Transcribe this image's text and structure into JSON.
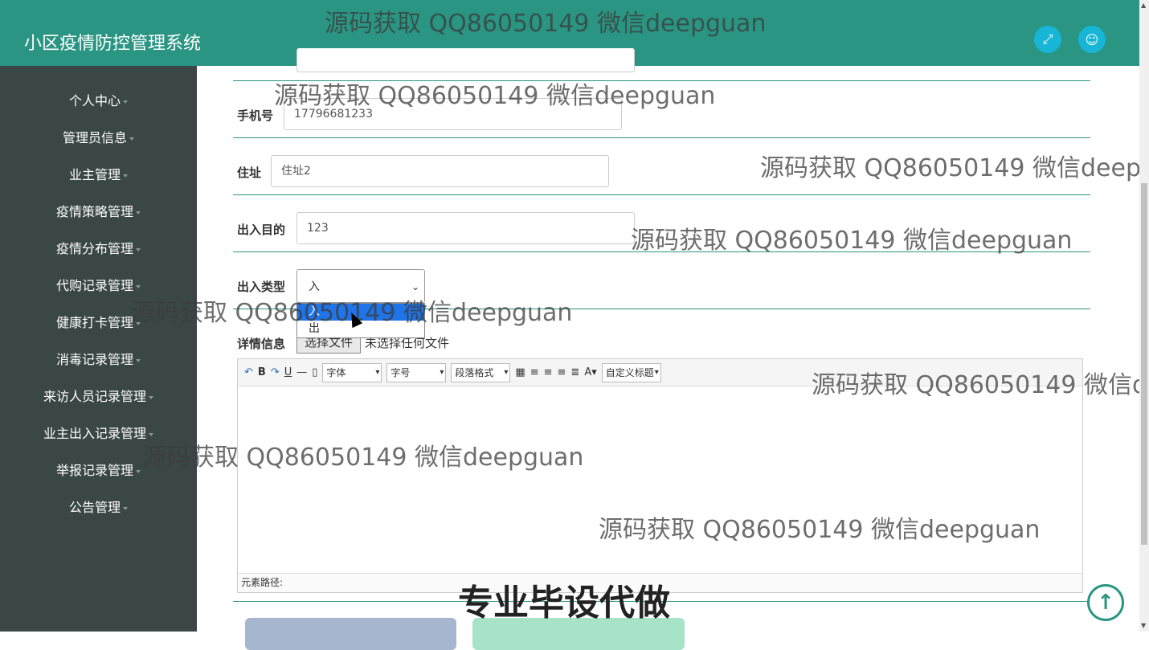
{
  "header": {
    "title": "小区疫情防控管理系统",
    "icons": [
      "fullscreen-icon",
      "user-icon"
    ]
  },
  "sidebar": {
    "items": [
      {
        "label": "个人中心"
      },
      {
        "label": "管理员信息"
      },
      {
        "label": "业主管理"
      },
      {
        "label": "疫情策略管理"
      },
      {
        "label": "疫情分布管理"
      },
      {
        "label": "代购记录管理"
      },
      {
        "label": "健康打卡管理"
      },
      {
        "label": "消毒记录管理"
      },
      {
        "label": "来访人员记录管理"
      },
      {
        "label": "业主出入记录管理"
      },
      {
        "label": "举报记录管理"
      },
      {
        "label": "公告管理"
      }
    ]
  },
  "form": {
    "phone": {
      "label": "手机号",
      "value": "17796681233"
    },
    "address": {
      "label": "住址",
      "value": "住址2"
    },
    "purpose": {
      "label": "出入目的",
      "value": "123"
    },
    "type": {
      "label": "出入类型",
      "value": "入",
      "options": [
        "入",
        "出"
      ]
    },
    "detail": {
      "label": "详情信息",
      "file_button": "选择文件",
      "file_status": "未选择任何文件"
    }
  },
  "editor": {
    "font": "字体",
    "size": "字号",
    "paragraph": "段落格式",
    "custom_title": "自定义标题",
    "status": "元素路径:"
  },
  "watermarks": {
    "text": "源码获取 QQ86050149 微信deepguan",
    "big": "专业毕设代做"
  },
  "colors": {
    "primary": "#2a9582",
    "sidebar": "#3b4647",
    "select_highlight": "#1e74e8"
  }
}
